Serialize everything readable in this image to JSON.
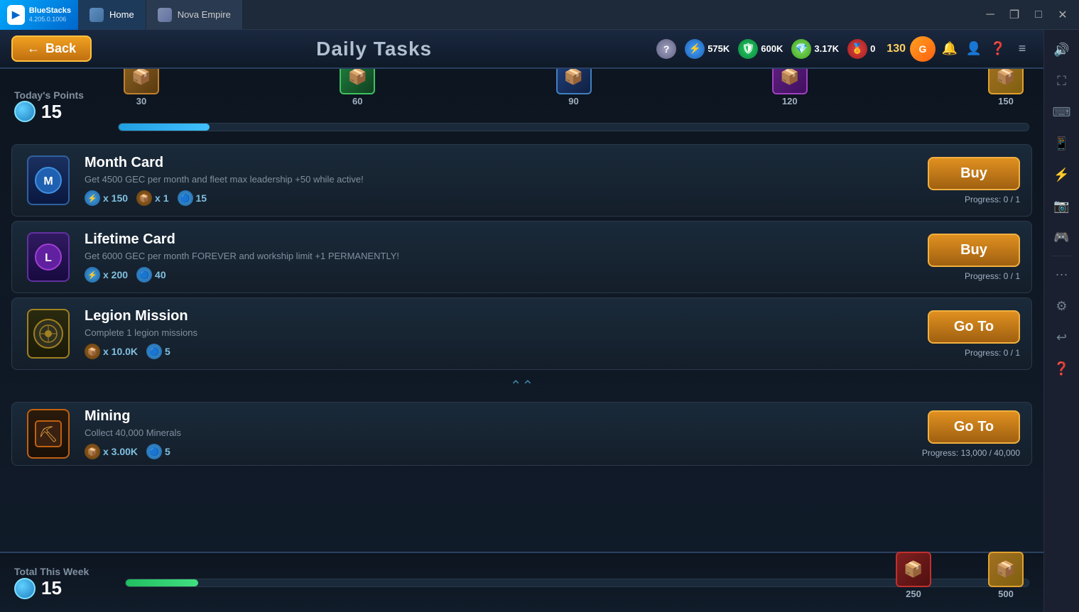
{
  "titlebar": {
    "app_name": "BlueStacks",
    "app_version": "4.205.0.1006",
    "tabs": [
      {
        "label": "Home",
        "type": "home",
        "active": false
      },
      {
        "label": "Nova Empire",
        "type": "nova",
        "active": true
      }
    ],
    "window_controls": {
      "minimize": "─",
      "maximize": "□",
      "close": "✕",
      "restore": "❐"
    }
  },
  "topbar": {
    "back_label": "Back",
    "page_title": "Daily Tasks",
    "resources": [
      {
        "type": "question",
        "value": "",
        "label": "?"
      },
      {
        "type": "energy",
        "value": "575K"
      },
      {
        "type": "shield",
        "value": "600K"
      },
      {
        "type": "crystal",
        "value": "3.17K"
      },
      {
        "type": "badge",
        "value": "0"
      }
    ],
    "gold": "130",
    "top_icons": [
      "🔔",
      "👤",
      "❓",
      "≡"
    ]
  },
  "daily_tasks": {
    "section_label": "Today's Points",
    "points": "15",
    "milestones": [
      {
        "value": "30",
        "style": "bronze",
        "emoji": "📦"
      },
      {
        "value": "60",
        "style": "green",
        "emoji": "📦"
      },
      {
        "value": "90",
        "style": "blue",
        "emoji": "📦"
      },
      {
        "value": "120",
        "style": "purple",
        "emoji": "📦"
      },
      {
        "value": "150",
        "style": "gold",
        "emoji": "📦"
      }
    ],
    "progress_pct": "10"
  },
  "tasks": [
    {
      "id": "month-card",
      "name": "Month Card",
      "desc": "Get 4500 GEC per month and fleet max leadership +50 while active!",
      "icon_style": "month",
      "icon_emoji": "🔷",
      "rewards": [
        {
          "icon": "blue",
          "label": "x 150"
        },
        {
          "icon": "chest",
          "label": "x 1"
        },
        {
          "icon": "blue",
          "label": "15"
        }
      ],
      "action": "Buy",
      "progress": "Progress: 0 / 1"
    },
    {
      "id": "lifetime-card",
      "name": "Lifetime Card",
      "desc": "Get 6000 GEC per month FOREVER and workship limit +1 PERMANENTLY!",
      "icon_style": "lifetime",
      "icon_emoji": "🔮",
      "rewards": [
        {
          "icon": "blue",
          "label": "x 200"
        },
        {
          "icon": "blue",
          "label": "40"
        }
      ],
      "action": "Buy",
      "progress": "Progress: 0 / 1"
    },
    {
      "id": "legion-mission",
      "name": "Legion Mission",
      "desc": "Complete 1 legion missions",
      "icon_style": "legion",
      "icon_emoji": "🌐",
      "rewards": [
        {
          "icon": "chest",
          "label": "x 10.0K"
        },
        {
          "icon": "blue",
          "label": "5"
        }
      ],
      "action": "Go To",
      "progress": "Progress: 0 / 1"
    },
    {
      "id": "mining",
      "name": "Mining",
      "desc": "Collect 40,000 Minerals",
      "icon_style": "mining",
      "icon_emoji": "⛏️",
      "rewards": [
        {
          "icon": "chest",
          "label": "x 3.00K"
        },
        {
          "icon": "blue",
          "label": "5"
        }
      ],
      "action": "Go To",
      "progress": "Progress: 13,000 / 40,000"
    }
  ],
  "weekly": {
    "section_label": "Total This Week",
    "points": "15",
    "milestones": [
      {
        "value": "250",
        "style": "red",
        "emoji": "📦"
      },
      {
        "value": "500",
        "style": "gold-w",
        "emoji": "📦"
      }
    ],
    "progress_pct": "8"
  },
  "right_sidebar": {
    "icons": [
      "🔊",
      "⛶",
      "⌨",
      "📱",
      "⚡",
      "📷",
      "🎮",
      "⋯",
      "⚙",
      "↩"
    ]
  }
}
